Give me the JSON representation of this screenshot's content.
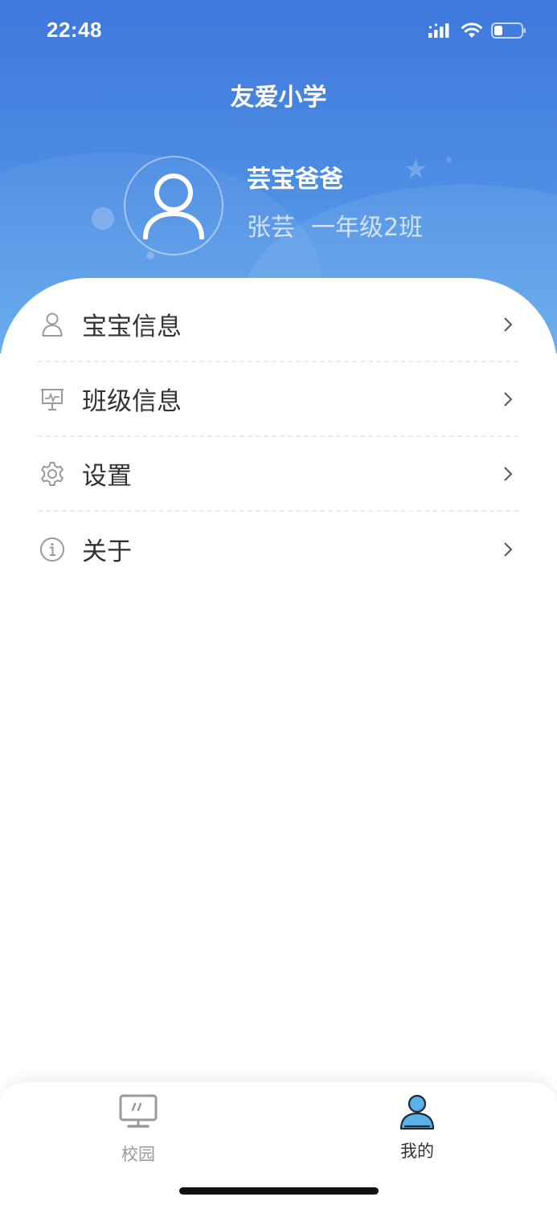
{
  "status_bar": {
    "time": "22:48"
  },
  "header": {
    "title": "友爱小学",
    "user_name": "芸宝爸爸",
    "child_name": "张芸",
    "class_name": "一年级2班"
  },
  "menu": {
    "items": [
      {
        "label": "宝宝信息",
        "icon": "person-icon"
      },
      {
        "label": "班级信息",
        "icon": "presentation-board-icon"
      },
      {
        "label": "设置",
        "icon": "gear-icon"
      },
      {
        "label": "关于",
        "icon": "info-icon"
      }
    ]
  },
  "tabbar": {
    "tabs": [
      {
        "label": "校园",
        "icon": "monitor-icon",
        "active": false
      },
      {
        "label": "我的",
        "icon": "user-profile-icon",
        "active": true
      }
    ]
  },
  "colors": {
    "header_top": "#3f78dd",
    "header_bottom": "#61a8ec",
    "active_tab_icon": "#5ab1e8",
    "inactive_tab": "#9a9a9a"
  }
}
